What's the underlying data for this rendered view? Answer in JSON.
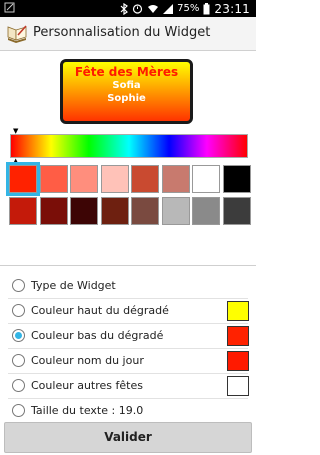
{
  "status_bar": {
    "battery_percent": "75%",
    "time": "23:11",
    "icons": [
      "bluetooth-icon",
      "alarm-icon",
      "wifi-icon",
      "signal-icon",
      "battery-icon"
    ]
  },
  "action_bar": {
    "title": "Personnalisation du Widget",
    "icon": "app-logo-icon"
  },
  "preview": {
    "title": "Fête des Mères",
    "names": [
      "Sofia",
      "Sophie"
    ],
    "gradient_top": "#ffff00",
    "gradient_bottom": "#ff3300",
    "title_color": "#ff1a00"
  },
  "palette": {
    "row1": [
      "#ff2200",
      "#ff5d45",
      "#ff8e7d",
      "#ffc2b8",
      "#c94a30",
      "#c87a6e",
      "#ffffff",
      "#000000"
    ],
    "row2": [
      "#c41a0a",
      "#7a0e08",
      "#3d0505",
      "#6e2010",
      "#7a4a40",
      "#b8b8b8",
      "#8a8a8a",
      "#3c3c3c"
    ],
    "selected_index": 0
  },
  "options": [
    {
      "label": "Type de Widget",
      "checked": false,
      "swatch": null
    },
    {
      "label": "Couleur haut du dégradé",
      "checked": false,
      "swatch": "#ffff00"
    },
    {
      "label": "Couleur bas du dégradé",
      "checked": true,
      "swatch": "#ff2200"
    },
    {
      "label": "Couleur nom du jour",
      "checked": false,
      "swatch": "#ff1a00"
    },
    {
      "label": "Couleur autres fêtes",
      "checked": false,
      "swatch": "#ffffff"
    },
    {
      "label": "Taille du texte : 19.0",
      "checked": false,
      "swatch": null
    }
  ],
  "validate_label": "Valider"
}
